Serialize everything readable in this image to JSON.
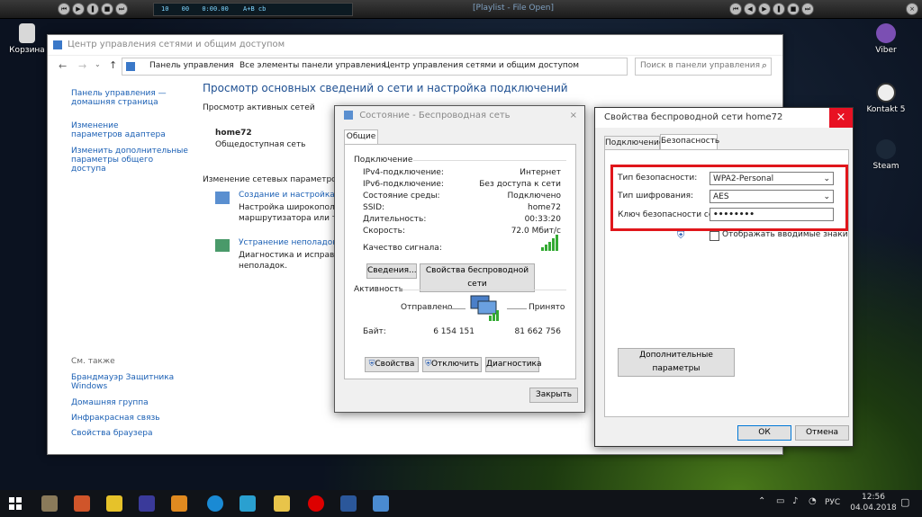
{
  "winamp": {
    "time1": "10",
    "time2": "00",
    "time3": "0:00.00",
    "mode": "A+B cb",
    "title": "[Playlist - File Open]"
  },
  "desktop": {
    "recycle": "Корзина",
    "viber": "Viber",
    "kontakt": "Kontakt 5",
    "steam": "Steam"
  },
  "cp": {
    "title": "Центр управления сетями и общим доступом",
    "breadcrumb": [
      "Панель управления",
      "Все элементы панели управления",
      "Центр управления сетями и общим доступом"
    ],
    "search_placeholder": "Поиск в панели управления",
    "sidebar": [
      "Панель управления — домашняя страница",
      "Изменение параметров адаптера",
      "Изменить дополнительные параметры общего доступа"
    ],
    "see_also": "См. также",
    "see_also_items": [
      "Брандмауэр Защитника Windows",
      "Домашняя группа",
      "Инфракрасная связь",
      "Свойства браузера"
    ],
    "heading": "Просмотр основных сведений о сети и настройка подключений",
    "active_networks": "Просмотр активных сетей",
    "network_name": "home72",
    "network_type": "Общедоступная сеть",
    "change_settings": "Изменение сетевых параметров",
    "create_link": "Создание и настройка но",
    "create_desc1": "Настройка широкополос",
    "create_desc2": "маршрутизатора или точ",
    "troubleshoot_link": "Устранение неполадок",
    "troubleshoot_desc1": "Диагностика и исправлен",
    "troubleshoot_desc2": "неполадок."
  },
  "status": {
    "title": "Состояние - Беспроводная сеть",
    "tab": "Общие",
    "group_conn": "Подключение",
    "rows": [
      {
        "label": "IPv4-подключение:",
        "value": "Интернет"
      },
      {
        "label": "IPv6-подключение:",
        "value": "Без доступа к сети"
      },
      {
        "label": "Состояние среды:",
        "value": "Подключено"
      },
      {
        "label": "SSID:",
        "value": "home72"
      },
      {
        "label": "Длительность:",
        "value": "00:33:20"
      },
      {
        "label": "Скорость:",
        "value": "72.0 Мбит/с"
      }
    ],
    "signal": "Качество сигнала:",
    "details_btn": "Сведения...",
    "wprops_btn": "Свойства беспроводной сети",
    "group_activity": "Активность",
    "sent": "Отправлено",
    "received": "Принято",
    "bytes": "Байт:",
    "bytes_sent": "6 154 151",
    "bytes_recv": "81 662 756",
    "props_btn": "Свойства",
    "disable_btn": "Отключить",
    "diag_btn": "Диагностика",
    "close_btn": "Закрыть"
  },
  "props": {
    "title": "Свойства беспроводной сети home72",
    "close": "×",
    "tab1": "Подключение",
    "tab2": "Безопасность",
    "sec_type_label": "Тип безопасности:",
    "sec_type_value": "WPA2-Personal",
    "enc_label": "Тип шифрования:",
    "enc_value": "AES",
    "key_label": "Ключ безопасности сети",
    "key_value": "••••••••",
    "show_chars": "Отображать вводимые знаки",
    "advanced_btn": "Дополнительные параметры",
    "ok": "ОК",
    "cancel": "Отмена",
    "highlight_color": "#e0161b"
  },
  "taskbar": {
    "lang": "РУС",
    "time": "12:56",
    "date": "04.04.2018"
  }
}
